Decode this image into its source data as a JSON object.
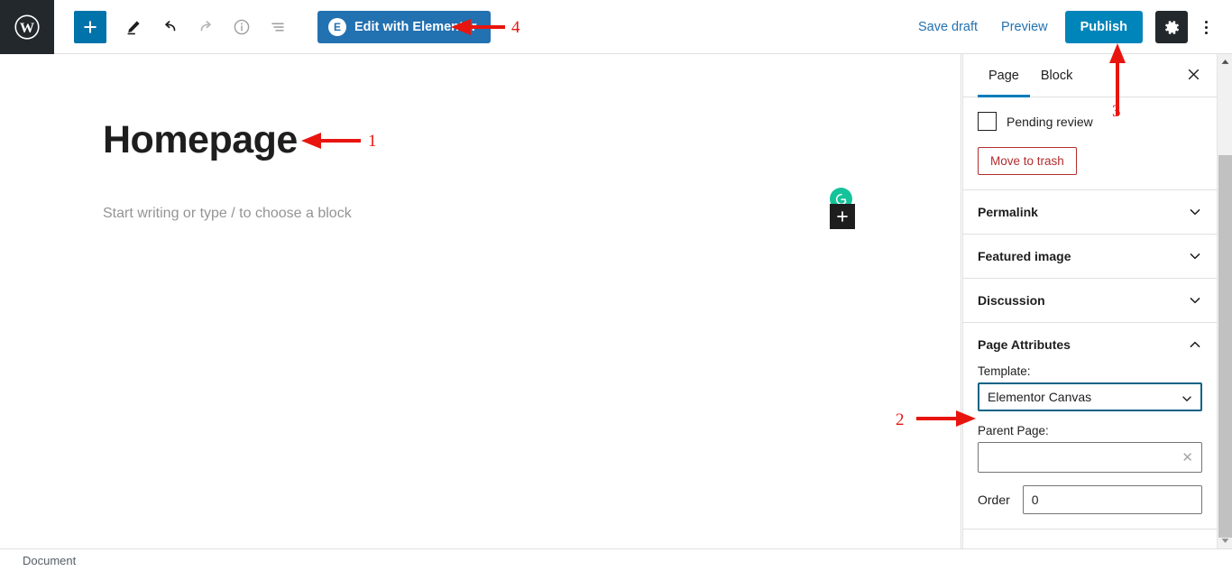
{
  "topbar": {
    "wp_logo": "wordpress-logo",
    "tools": [
      {
        "name": "add-block-button",
        "icon": "plus-icon",
        "label": "+"
      },
      {
        "name": "edit-tool-button",
        "icon": "pencil-icon",
        "label": ""
      },
      {
        "name": "undo-button",
        "icon": "undo-arrow-icon",
        "label": ""
      },
      {
        "name": "redo-button",
        "icon": "redo-arrow-icon",
        "label": ""
      },
      {
        "name": "details-button",
        "icon": "info-circle-icon",
        "label": ""
      },
      {
        "name": "list-view-button",
        "icon": "list-view-icon",
        "label": ""
      }
    ],
    "elementor_button": "Edit with Elementor",
    "elementor_badge": "E",
    "save_draft": "Save draft",
    "preview": "Preview",
    "publish": "Publish",
    "settings_icon": "gear-icon",
    "more_icon": "kebab-menu-icon"
  },
  "canvas": {
    "post_title": "Homepage",
    "block_placeholder": "Start writing or type / to choose a block",
    "grammarly_icon": "grammarly-icon",
    "inserter_icon": "plus-icon"
  },
  "statusbar": {
    "label": "Document"
  },
  "sidebar": {
    "tabs": [
      {
        "label": "Page",
        "active": true
      },
      {
        "label": "Block",
        "active": false
      }
    ],
    "close_icon": "close-icon",
    "status": {
      "pending_review_label": "Pending review",
      "pending_review_checked": false,
      "move_to_trash": "Move to trash"
    },
    "panels": [
      {
        "title": "Permalink",
        "expanded": false
      },
      {
        "title": "Featured image",
        "expanded": false
      },
      {
        "title": "Discussion",
        "expanded": false
      }
    ],
    "page_attributes": {
      "title": "Page Attributes",
      "expanded": true,
      "template_label": "Template:",
      "template_value": "Elementor Canvas",
      "parent_page_label": "Parent Page:",
      "parent_page_value": "",
      "parent_page_clear_icon": "clear-x-icon",
      "order_label": "Order",
      "order_value": "0"
    }
  },
  "annotations": [
    {
      "number": "1",
      "target": "post-title"
    },
    {
      "number": "2",
      "target": "template-select"
    },
    {
      "number": "3",
      "target": "publish-button"
    },
    {
      "number": "4",
      "target": "elementor-button"
    }
  ],
  "colors": {
    "wp_admin_dark": "#23282d",
    "wp_blue": "#0073aa",
    "publish_blue": "#0085ba",
    "elementor_blue": "#2271b1",
    "accent_tab": "#007cba",
    "trash_red": "#b32d2e",
    "annotation_red": "#e8150f",
    "grammarly_green": "#15c39a"
  }
}
